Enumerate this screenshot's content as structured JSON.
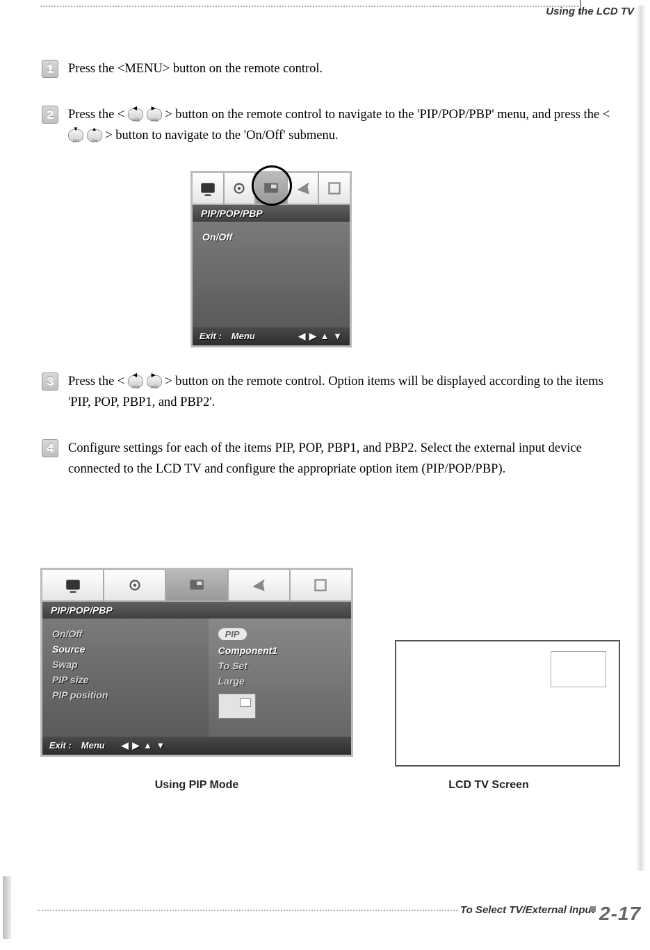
{
  "header": {
    "section_label": "Using the LCD TV"
  },
  "steps": [
    {
      "num": "1",
      "text": "Press the <MENU> button on the remote control."
    },
    {
      "num": "2",
      "text_part1": "Press the <",
      "text_part2": "> button on the remote control to navigate to the 'PIP/POP/PBP' menu, and press the <",
      "text_part3": "> button to navigate to the 'On/Off' submenu."
    },
    {
      "num": "3",
      "text_part1": "Press the <",
      "text_part2": "> button on the remote control. Option items will be displayed according to the items 'PIP, POP, PBP1, and PBP2'."
    },
    {
      "num": "4",
      "text": "Configure settings for each of the items PIP, POP, PBP1, and PBP2.  Select the external input device connected to the LCD TV and configure the appropriate option item (PIP/POP/PBP)."
    }
  ],
  "osd1": {
    "title": "PIP/POP/PBP",
    "item": "On/Off",
    "footer_exit": "Exit :",
    "footer_menu": "Menu",
    "footer_arrows": "◀ ▶ ▲ ▼"
  },
  "osd2": {
    "title": "PIP/POP/PBP",
    "left_items": [
      "On/Off",
      "Source",
      "Swap",
      "PIP size",
      "PIP position"
    ],
    "right_items": [
      "PIP",
      "Component1",
      "To Set",
      "Large"
    ],
    "right_pill_index": 0,
    "footer_exit": "Exit :",
    "footer_menu": "Menu",
    "footer_arrows": "◀ ▶ ▲ ▼"
  },
  "captions": {
    "left": "Using PIP Mode",
    "right": "LCD TV Screen"
  },
  "footer": {
    "label": "To Select TV/External Input",
    "page": "2-17"
  }
}
